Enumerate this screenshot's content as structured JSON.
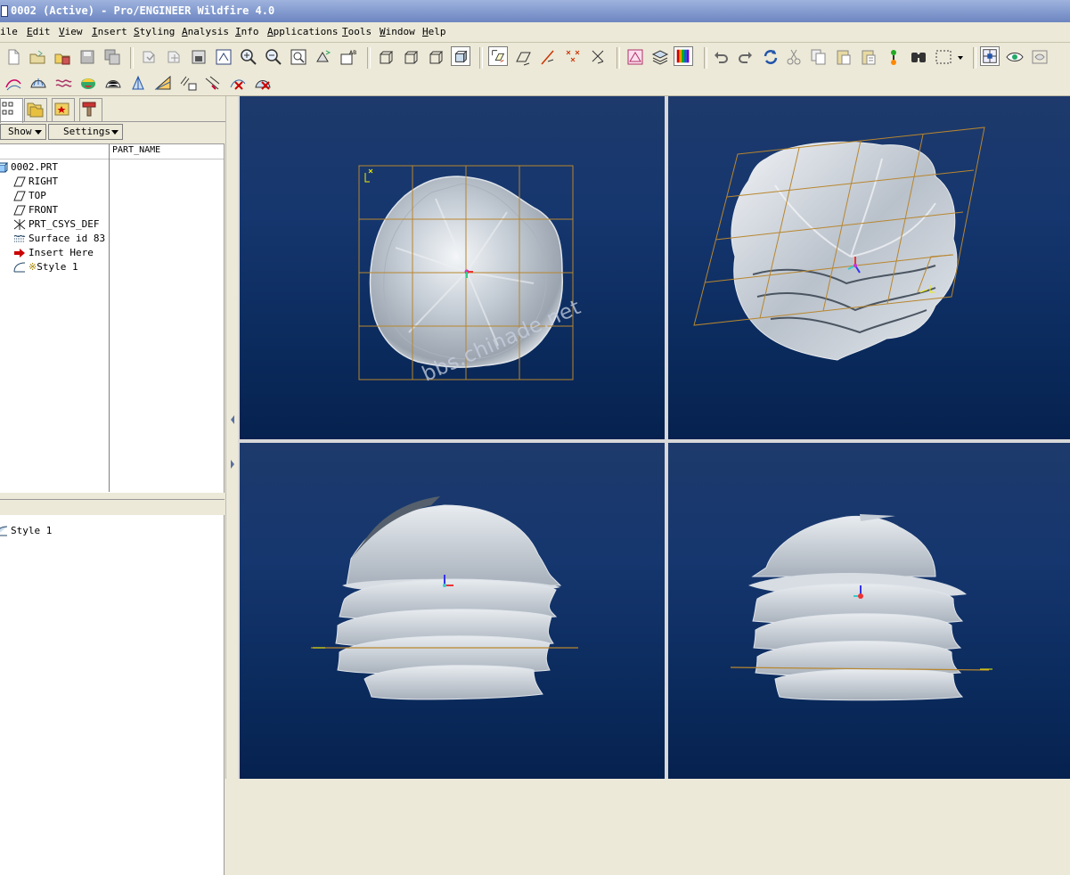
{
  "window": {
    "title": "0002 (Active) - Pro/ENGINEER Wildfire 4.0"
  },
  "menus": [
    {
      "label": "ile",
      "accel": ""
    },
    {
      "label": "Edit",
      "accel": "E"
    },
    {
      "label": "View",
      "accel": "V"
    },
    {
      "label": "Insert",
      "accel": "I"
    },
    {
      "label": "Styling",
      "accel": "S"
    },
    {
      "label": "Analysis",
      "accel": "A"
    },
    {
      "label": "Info",
      "accel": "I"
    },
    {
      "label": "Applications",
      "accel": "A"
    },
    {
      "label": "Tools",
      "accel": "T"
    },
    {
      "label": "Window",
      "accel": "W"
    },
    {
      "label": "Help",
      "accel": "H"
    }
  ],
  "navigator": {
    "show_label": "Show",
    "settings_label": "Settings",
    "column_header": "PART_NAME"
  },
  "tree": [
    {
      "label": "0002.PRT",
      "icon": "part-icon"
    },
    {
      "label": "RIGHT",
      "icon": "datum-plane-icon"
    },
    {
      "label": "TOP",
      "icon": "datum-plane-icon"
    },
    {
      "label": "FRONT",
      "icon": "datum-plane-icon"
    },
    {
      "label": "PRT_CSYS_DEF",
      "icon": "csys-icon"
    },
    {
      "label": "Surface id 83",
      "icon": "surface-icon"
    },
    {
      "label": "Insert Here",
      "icon": "insert-arrow-icon"
    },
    {
      "label": "Style 1",
      "icon": "style-feature-icon"
    }
  ],
  "layer_pane": {
    "item_label": "Style 1"
  },
  "watermark": "bbs.chinade.net",
  "colors": {
    "viewport_top": "#1e3a6c",
    "viewport_bottom": "#06214e",
    "datum_grid": "#b8862e",
    "surface": "#c9d2dc"
  }
}
